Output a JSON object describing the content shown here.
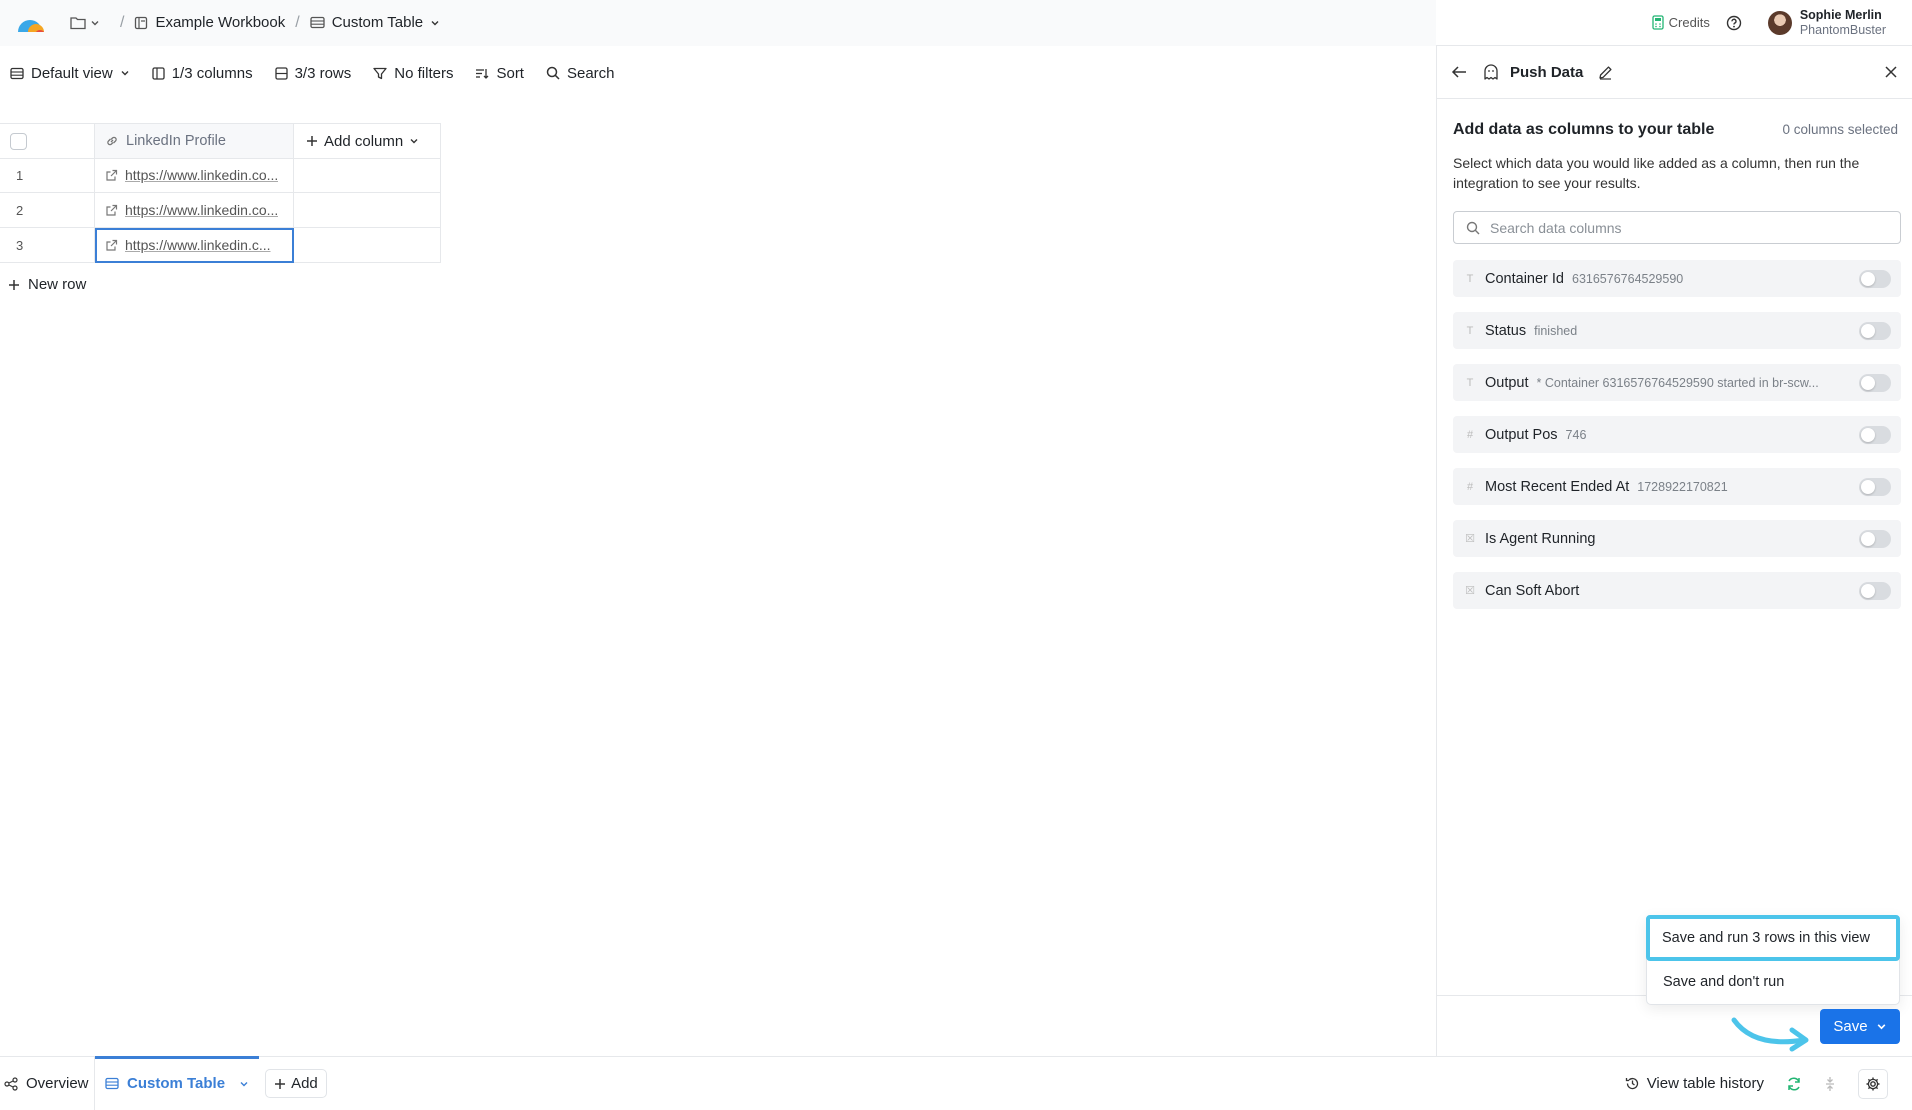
{
  "breadcrumb": {
    "workbook": "Example Workbook",
    "table": "Custom Table",
    "separator": "/"
  },
  "header": {
    "credits": "Credits",
    "user_name": "Sophie Merlin",
    "user_org": "PhantomBuster"
  },
  "toolbar": {
    "view": "Default view",
    "columns": "1/3 columns",
    "rows": "3/3 rows",
    "filters": "No filters",
    "sort": "Sort",
    "search": "Search"
  },
  "table": {
    "column_header": "LinkedIn Profile",
    "add_column": "Add column",
    "rows": [
      {
        "num": "1",
        "url": "https://www.linkedin.co..."
      },
      {
        "num": "2",
        "url": "https://www.linkedin.co..."
      },
      {
        "num": "3",
        "url": "https://www.linkedin.c..."
      }
    ],
    "new_row": "New row"
  },
  "panel": {
    "title": "Push Data",
    "heading": "Add data as columns to your table",
    "selected_count": "0 columns selected",
    "description": "Select which data you would like added as a column, then run the integration to see your results.",
    "search_placeholder": "Search data columns",
    "items": [
      {
        "type": "T",
        "label": "Container Id",
        "value": "6316576764529590"
      },
      {
        "type": "T",
        "label": "Status",
        "value": "finished"
      },
      {
        "type": "T",
        "label": "Output",
        "value": "* Container 6316576764529590 started in br-scw..."
      },
      {
        "type": "#",
        "label": "Output Pos",
        "value": "746"
      },
      {
        "type": "#",
        "label": "Most Recent Ended At",
        "value": "1728922170821"
      },
      {
        "type": "☒",
        "label": "Is Agent Running",
        "value": ""
      },
      {
        "type": "☒",
        "label": "Can Soft Abort",
        "value": ""
      }
    ]
  },
  "menu": {
    "run_option": "Save and run 3 rows in this view",
    "no_run_option": "Save and don't run"
  },
  "save_button": "Save",
  "bottombar": {
    "overview": "Overview",
    "active_tab": "Custom Table",
    "add": "Add",
    "history": "View table history"
  },
  "colors": {
    "accent": "#1a73e8",
    "highlight": "#4cc4ea",
    "refresh": "#22b573"
  }
}
